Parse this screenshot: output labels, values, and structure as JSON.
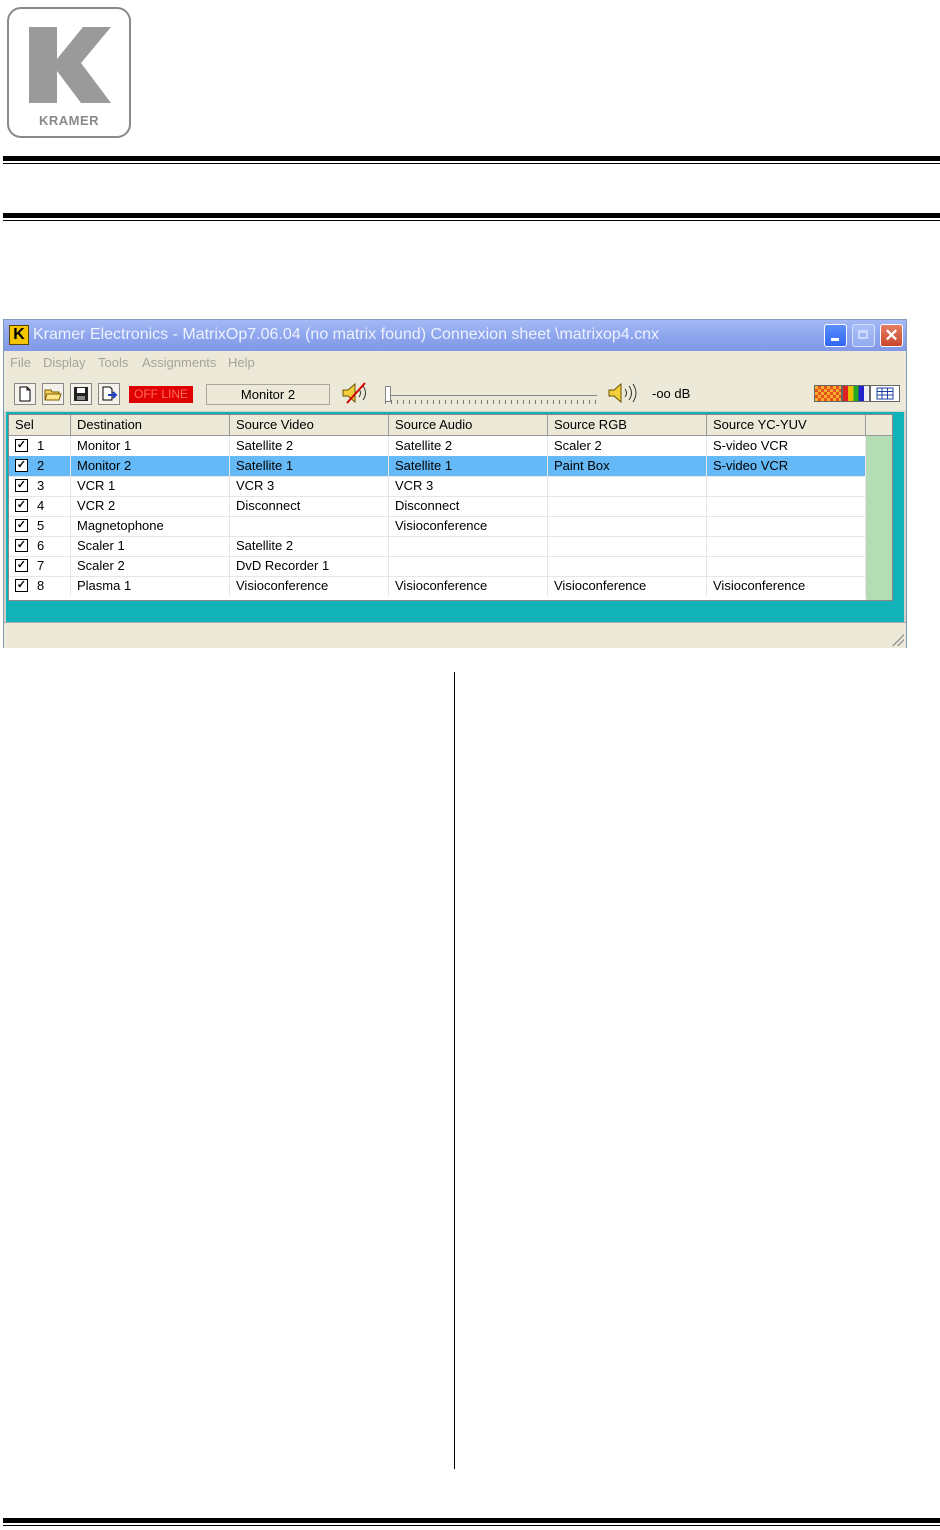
{
  "logo": {
    "text": "KRAMER"
  },
  "window": {
    "title": "Kramer Electronics - MatrixOp7.06.04 (no matrix found) Connexion sheet \\matrixop4.cnx",
    "close_glyph": "✕"
  },
  "menu": [
    "File",
    "Display",
    "Tools",
    "Assignments",
    "Help"
  ],
  "toolbar": {
    "status": "OFF LINE",
    "destination": "Monitor 2",
    "volume": "-oo dB",
    "slider_value": 0,
    "icons": [
      "new-file-icon",
      "open-folder-icon",
      "save-icon",
      "export-icon",
      "mute-speaker-icon",
      "speaker-icon",
      "matrix-view-icon",
      "color-bars-icon",
      "table-view-icon"
    ]
  },
  "grid": {
    "headers": [
      "Sel",
      "Destination",
      "Source Video",
      "Source Audio",
      "Source RGB",
      "Source YC-YUV"
    ],
    "rows": [
      {
        "num": "1",
        "dest": "Monitor 1",
        "video": "Satellite 2",
        "audio": "Satellite 2",
        "rgb": "Scaler 2",
        "yc": "S-video VCR",
        "selected": false
      },
      {
        "num": "2",
        "dest": "Monitor 2",
        "video": "Satellite 1",
        "audio": "Satellite 1",
        "rgb": "Paint Box",
        "yc": "S-video VCR",
        "selected": true
      },
      {
        "num": "3",
        "dest": "VCR 1",
        "video": "VCR 3",
        "audio": "VCR 3",
        "rgb": "",
        "yc": "",
        "selected": false
      },
      {
        "num": "4",
        "dest": "VCR 2",
        "video": "Disconnect",
        "audio": "Disconnect",
        "rgb": "",
        "yc": "",
        "selected": false
      },
      {
        "num": "5",
        "dest": "Magnetophone",
        "video": "",
        "audio": "Visioconference",
        "rgb": "",
        "yc": "",
        "selected": false
      },
      {
        "num": "6",
        "dest": "Scaler 1",
        "video": "Satellite 2",
        "audio": "",
        "rgb": "",
        "yc": "",
        "selected": false
      },
      {
        "num": "7",
        "dest": "Scaler 2",
        "video": "DvD Recorder 1",
        "audio": "",
        "rgb": "",
        "yc": "",
        "selected": false
      },
      {
        "num": "8",
        "dest": "Plasma 1",
        "video": "Visioconference",
        "audio": "Visioconference",
        "rgb": "Visioconference",
        "yc": "Visioconference",
        "selected": false
      }
    ],
    "check_glyph": "✓"
  },
  "colors": {
    "selected_row": "#64b9f6",
    "grid_bg": "#12b3b8",
    "offline_bg": "#e00000"
  }
}
